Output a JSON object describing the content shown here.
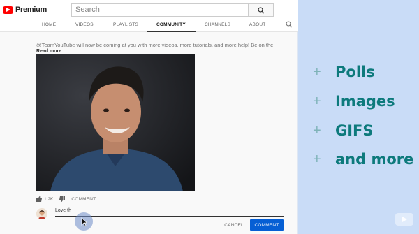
{
  "header": {
    "brand": "Premium",
    "search_placeholder": "Search"
  },
  "tabs": [
    {
      "label": "HOME",
      "active": false
    },
    {
      "label": "VIDEOS",
      "active": false
    },
    {
      "label": "PLAYLISTS",
      "active": false
    },
    {
      "label": "COMMUNITY",
      "active": true
    },
    {
      "label": "CHANNELS",
      "active": false
    },
    {
      "label": "ABOUT",
      "active": false
    }
  ],
  "post": {
    "text": "@TeamYouTube will now be coming at you with more videos, more tutorials, and more help! Be on the",
    "read_more": "Read more",
    "likes": "1.2K",
    "comment_label": "COMMENT"
  },
  "reply": {
    "value": "Love th",
    "cancel_label": "CANCEL",
    "submit_label": "COMMENT"
  },
  "features": [
    {
      "plus": "+",
      "label": "Polls"
    },
    {
      "plus": "+",
      "label": "Images"
    },
    {
      "plus": "+",
      "label": "GIFS"
    },
    {
      "plus": "+",
      "label": "and more"
    }
  ],
  "colors": {
    "brand_red": "#ff0000",
    "accent_blue": "#065fd4",
    "feature_teal": "#0d7a7c",
    "panel_bg": "#c9dcf7"
  }
}
